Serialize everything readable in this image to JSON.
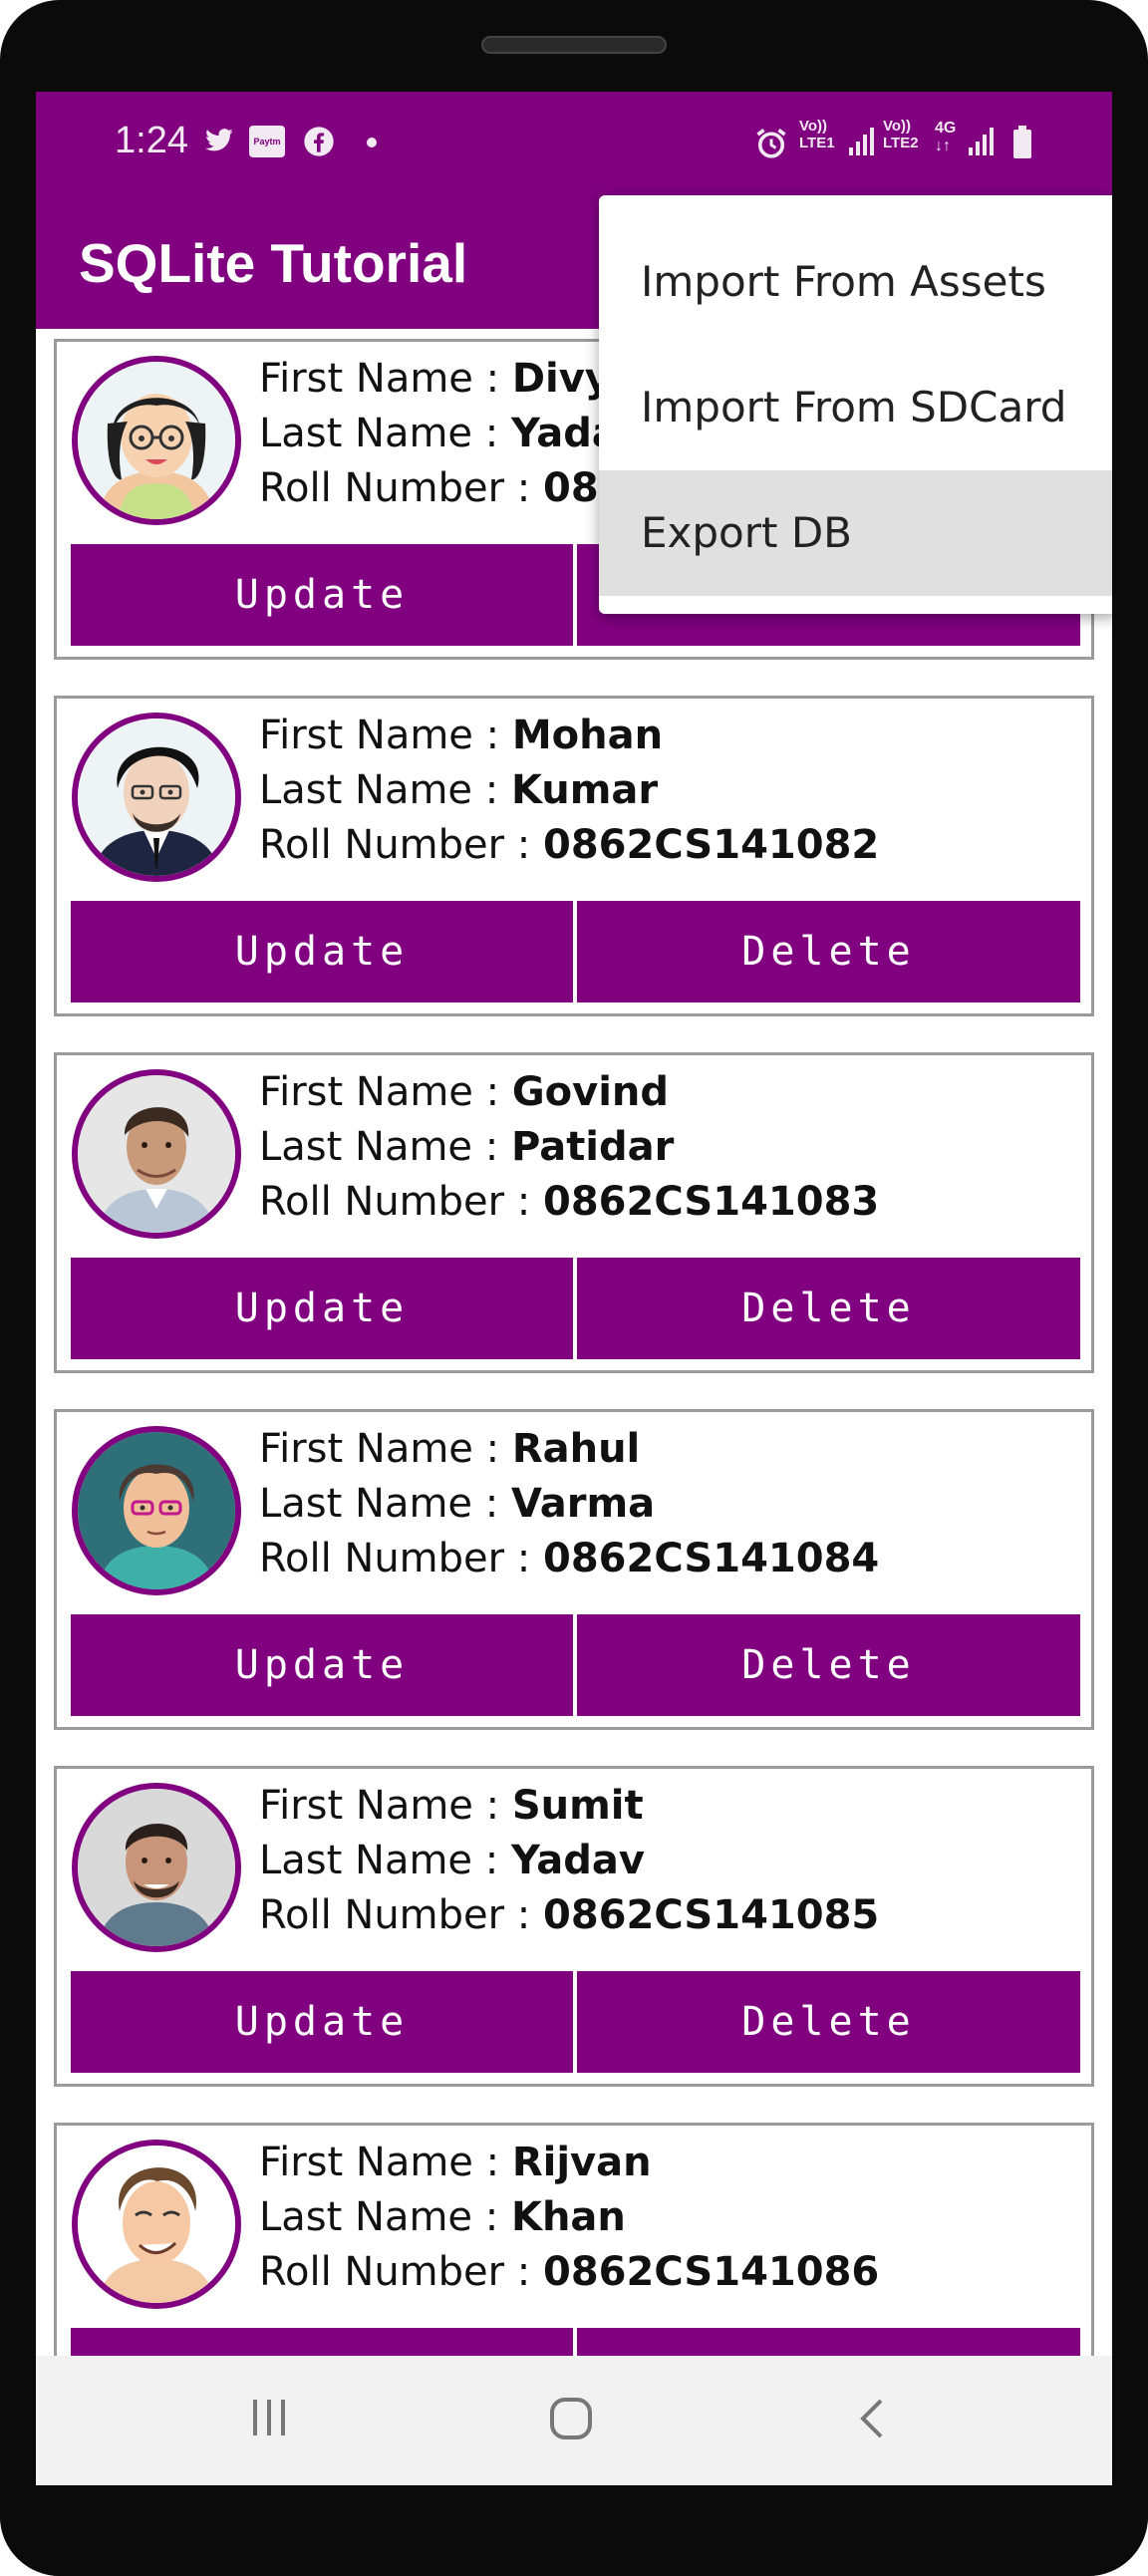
{
  "status_bar": {
    "time": "1:24",
    "icons": [
      "twitter-icon",
      "paytm-icon",
      "facebook-icon",
      "dot-icon",
      "alarm-icon",
      "volte-lte1-icon",
      "signal-icon",
      "volte-lte2-icon",
      "4g-icon",
      "signal-icon-2",
      "battery-icon"
    ],
    "paytm_text": "Paytm",
    "volte1": "Vo))",
    "lte1": "LTE1",
    "volte2": "Vo))",
    "lte2": "LTE2",
    "net": "4G"
  },
  "app_bar": {
    "title": "SQLite Tutorial"
  },
  "overflow_menu": {
    "items": [
      {
        "label": "Import From Assets"
      },
      {
        "label": "Import From SDCard"
      },
      {
        "label": "Export DB"
      }
    ]
  },
  "labels": {
    "first_name": "First Name : ",
    "last_name": "Last Name : ",
    "roll_number": "Roll Number : ",
    "update": "Update",
    "delete": "Delete"
  },
  "students": [
    {
      "first": "Divy",
      "last": "Yada",
      "roll": "08"
    },
    {
      "first": "Mohan",
      "last": "Kumar",
      "roll": "0862CS141082"
    },
    {
      "first": "Govind",
      "last": "Patidar",
      "roll": "0862CS141083"
    },
    {
      "first": "Rahul",
      "last": "Varma",
      "roll": "0862CS141084"
    },
    {
      "first": "Sumit",
      "last": "Yadav",
      "roll": "0862CS141085"
    },
    {
      "first": "Rijvan",
      "last": "Khan",
      "roll": "0862CS141086"
    }
  ],
  "colors": {
    "primary": "#800080",
    "menu_highlight": "#e0e0e0",
    "navbar_bg": "#f2f2f2"
  },
  "nav_bar": {
    "icons": [
      "recents-icon",
      "home-icon",
      "back-icon"
    ]
  }
}
